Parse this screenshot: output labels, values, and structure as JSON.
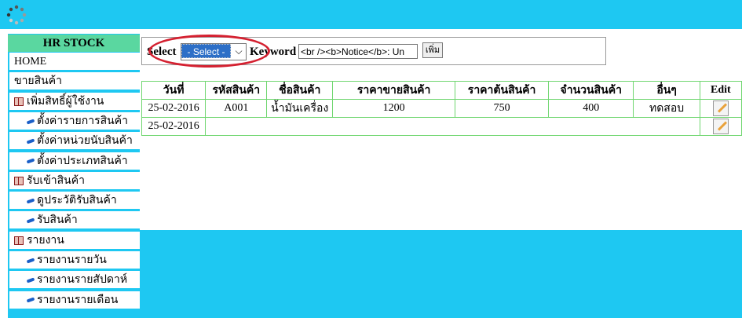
{
  "sidebar": {
    "title": "HR STOCK",
    "items": [
      {
        "label": "HOME",
        "type": "top"
      },
      {
        "label": "ขายสินค้า",
        "type": "top"
      },
      {
        "label": "เพิ่มสิทธิ์ผู้ใช้งาน",
        "type": "group"
      },
      {
        "label": "ตั้งค่ารายการสินค้า",
        "type": "sub"
      },
      {
        "label": "ตั้งค่าหน่วยนับสินค้า",
        "type": "sub"
      },
      {
        "label": "ตั้งค่าประเภทสินค้า",
        "type": "sub"
      },
      {
        "label": "รับเข้าสินค้า",
        "type": "group"
      },
      {
        "label": "ดูประวัติรับสินค้า",
        "type": "sub"
      },
      {
        "label": "รับสินค้า",
        "type": "sub"
      },
      {
        "label": "รายงาน",
        "type": "group"
      },
      {
        "label": "รายงานรายวัน",
        "type": "sub"
      },
      {
        "label": "รายงานรายสัปดาห์",
        "type": "sub"
      },
      {
        "label": "รายงานรายเดือน",
        "type": "sub"
      }
    ]
  },
  "search": {
    "select_label": "Select",
    "select_value": "- Select -",
    "keyword_label": "Keyword",
    "keyword_value": "<br /><b>Notice</b>:  Un",
    "add_button": "เพิ่ม"
  },
  "table": {
    "headers": [
      "วันที่",
      "รหัสสินค้า",
      "ชื่อสินค้า",
      "ราคาขายสินค้า",
      "ราคาต้นสินค้า",
      "จำนวนสินค้า",
      "อื่นๆ",
      "Edit"
    ],
    "rows": [
      [
        "25-02-2016",
        "A001",
        "น้ำมันเครื่อง",
        "1200",
        "750",
        "400",
        "ทดสอบ"
      ],
      [
        "25-02-2016",
        "",
        "",
        "",
        "",
        "",
        ""
      ]
    ]
  },
  "colors": {
    "header_bg": "#1ec8f2",
    "sidebar_title_bg": "#5ad7a0",
    "table_border": "#6fd66f",
    "highlight": "#d42030"
  }
}
